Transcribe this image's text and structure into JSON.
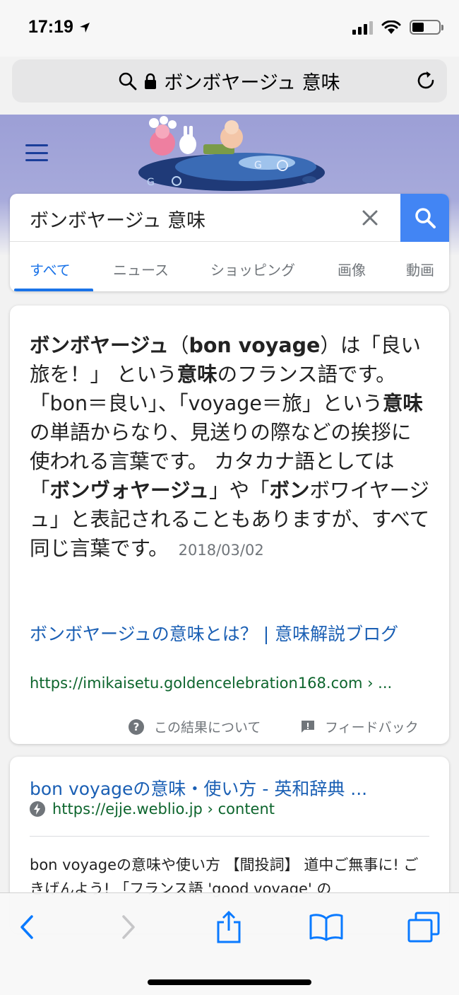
{
  "status_bar": {
    "time": "17:19"
  },
  "url_bar": {
    "text": "ボンボヤージュ 意味"
  },
  "search": {
    "query": "ボンボヤージュ 意味",
    "tabs": [
      "すべて",
      "ニュース",
      "ショッピング",
      "画像",
      "動画"
    ],
    "active_tab": "すべて"
  },
  "featured_snippet": {
    "text_parts": [
      {
        "t": "ボンボヤージュ",
        "b": true
      },
      {
        "t": "（",
        "b": false
      },
      {
        "t": "bon voyage",
        "b": true
      },
      {
        "t": "）は「良い旅を！」 という",
        "b": false
      },
      {
        "t": "意味",
        "b": true
      },
      {
        "t": "のフランス語です。 「bon＝良い」、「voyage＝旅」という",
        "b": false
      },
      {
        "t": "意味",
        "b": true
      },
      {
        "t": "の単語からなり、見送りの際などの挨拶に使われる言葉です。 カタカナ語としては「",
        "b": false
      },
      {
        "t": "ボンヴォヤージュ",
        "b": true
      },
      {
        "t": "」や「",
        "b": false
      },
      {
        "t": "ボン",
        "b": true
      },
      {
        "t": "ボワイヤージュ」と表記されることもありますが、すべて同じ言葉です。",
        "b": false
      }
    ],
    "date": "2018/03/02",
    "title": "ボンボヤージュの意味とは？ | 意味解説ブログ",
    "url": "https://imikaisetu.goldencelebration168.com › ...",
    "footer_about": "この結果について",
    "footer_feedback": "フィードバック"
  },
  "result2": {
    "title": "bon voyageの意味・使い方 - 英和辞典 ...",
    "url": "https://ejje.weblio.jp › content",
    "snippet": "bon voyageの意味や使い方 【間投詞】 道中ご無事に! ごきげんよう! 「フランス語 'good voyage' の"
  },
  "toolbar": {
    "icons": [
      "back-icon",
      "forward-icon",
      "share-icon",
      "bookmarks-icon",
      "tabs-icon"
    ]
  },
  "colors": {
    "link": "#1a5fb4",
    "url_green": "#0d652d",
    "accent": "#4285f4",
    "safari_blue": "#0a7aff",
    "header_bg": "#9c9fd6"
  }
}
